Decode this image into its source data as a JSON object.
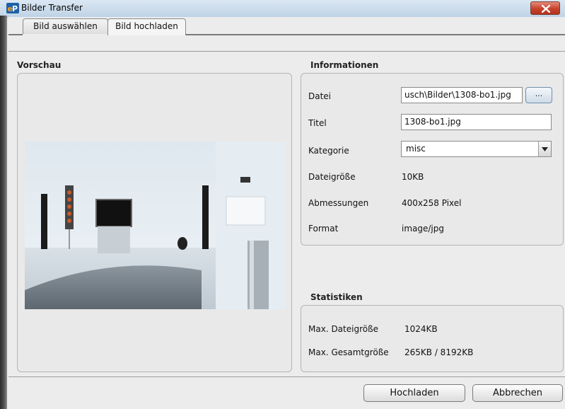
{
  "window": {
    "title": "Bilder Transfer",
    "logo": "eP"
  },
  "tabs": [
    {
      "label": "Bild auswählen",
      "active": false
    },
    {
      "label": "Bild hochladen",
      "active": true
    }
  ],
  "preview": {
    "title": "Vorschau"
  },
  "info": {
    "title": "Informationen",
    "datei_label": "Datei",
    "datei_value": "usch\\Bilder\\1308-bo1.jpg",
    "browse_label": "...",
    "titel_label": "Titel",
    "titel_value": "1308-bo1.jpg",
    "kategorie_label": "Kategorie",
    "kategorie_value": "misc",
    "groesse_label": "Dateigröße",
    "groesse_value": "10KB",
    "abmessungen_label": "Abmessungen",
    "abmessungen_value": "400x258 Pixel",
    "format_label": "Format",
    "format_value": "image/jpg"
  },
  "stats": {
    "title": "Statistiken",
    "max_datei_label": "Max. Dateigröße",
    "max_datei_value": "1024KB",
    "max_gesamt_label": "Max. Gesamtgröße",
    "max_gesamt_value": "265KB / 8192KB"
  },
  "buttons": {
    "upload": "Hochladen",
    "cancel": "Abbrechen"
  },
  "icons": {
    "close": "close-icon",
    "dropdown": "chevron-down-icon",
    "logo": "app-logo-icon"
  }
}
